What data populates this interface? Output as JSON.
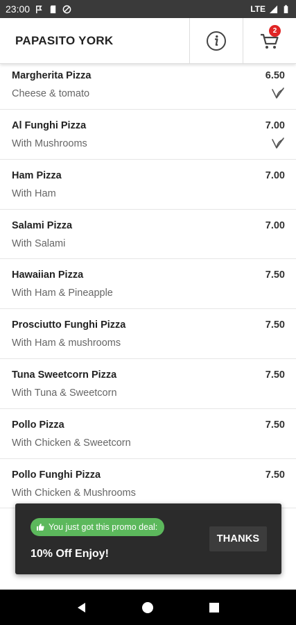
{
  "status_bar": {
    "time": "23:00",
    "network": "LTE"
  },
  "header": {
    "restaurant_name": "PAPASITO YORK",
    "cart_count": "2"
  },
  "menu_items": [
    {
      "name": "Margherita Pizza",
      "description": "Cheese & tomato",
      "price": "6.50",
      "vegetarian": true
    },
    {
      "name": "Al Funghi Pizza",
      "description": "With Mushrooms",
      "price": "7.00",
      "vegetarian": true
    },
    {
      "name": "Ham Pizza",
      "description": "With Ham",
      "price": "7.00",
      "vegetarian": false
    },
    {
      "name": "Salami Pizza",
      "description": "With Salami",
      "price": "7.00",
      "vegetarian": false
    },
    {
      "name": "Hawaiian Pizza",
      "description": "With Ham & Pineapple",
      "price": "7.50",
      "vegetarian": false
    },
    {
      "name": "Prosciutto Funghi Pizza",
      "description": "With Ham & mushrooms",
      "price": "7.50",
      "vegetarian": false
    },
    {
      "name": "Tuna Sweetcorn Pizza",
      "description": "With Tuna & Sweetcorn",
      "price": "7.50",
      "vegetarian": false
    },
    {
      "name": "Pollo Pizza",
      "description": "With Chicken & Sweetcorn",
      "price": "7.50",
      "vegetarian": false
    },
    {
      "name": "Pollo Funghi Pizza",
      "description": "With Chicken & Mushrooms",
      "price": "7.50",
      "vegetarian": false
    }
  ],
  "promo": {
    "badge_text": "You just got this promo deal:",
    "title": "10% Off Enjoy!",
    "button_label": "THANKS",
    "badge_color": "#5cb85c"
  },
  "colors": {
    "status_bar": "#3a3a3a",
    "toast_bg": "#2b2b2b",
    "badge": "#e02424"
  }
}
